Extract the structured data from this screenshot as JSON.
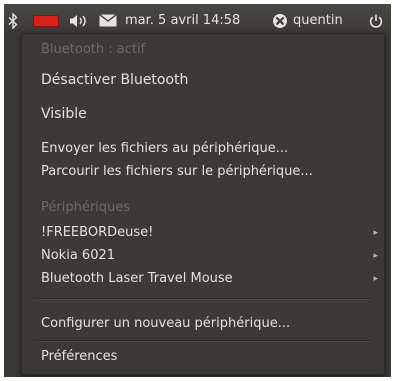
{
  "panel": {
    "bluetooth_icon": "bluetooth-icon",
    "battery_icon": "battery-icon",
    "volume_icon": "volume-icon",
    "mail_icon": "mail-icon",
    "clock": "mar. 5 avril 14:58",
    "user_icon": "user-icon",
    "username": "quentin",
    "power_icon": "power-icon"
  },
  "menu": {
    "status_header": "Bluetooth : actif",
    "disable_bluetooth": "Désactiver Bluetooth",
    "visible": "Visible",
    "send_files": "Envoyer les fichiers au périphérique...",
    "browse_files": "Parcourir les fichiers sur le périphérique...",
    "devices_header": "Périphériques",
    "devices": [
      "!FREEBORDeuse!",
      "Nokia 6021",
      "Bluetooth Laser Travel Mouse"
    ],
    "submenu_arrow": "▸",
    "configure_new": "Configurer un nouveau périphérique...",
    "preferences": "Préférences"
  },
  "colors": {
    "menu_bg": "#3c3a36",
    "panel_bg": "#3a3834",
    "battery": "#d8201c",
    "text": "#e4e2de",
    "header_text": "#6d6a64"
  }
}
